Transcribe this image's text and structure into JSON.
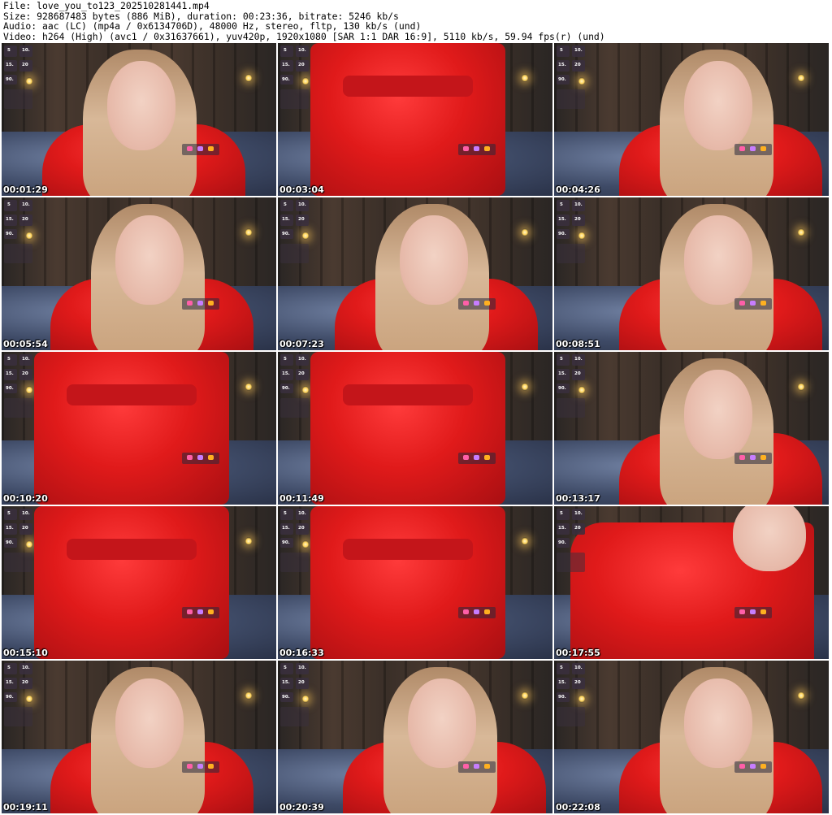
{
  "header": {
    "line1": "File: love_you_to123_202510281441.mp4",
    "line2": "Size: 928687483 bytes (886 MiB), duration: 00:23:36, bitrate: 5246 kb/s",
    "line3": "Audio: aac (LC) (mp4a / 0x6134706D), 48000 Hz, stereo, fltp, 130 kb/s (und)",
    "line4": "Video: h264 (High) (avc1 / 0x31637661), yuv420p, 1920x1080 [SAR 1:1 DAR 16:9], 5110 kb/s, 59.94 fps(r) (und)"
  },
  "thumbnails": [
    {
      "timestamp": "00:01:29",
      "scene": "portrait-left"
    },
    {
      "timestamp": "00:03:04",
      "scene": "robe-closeup"
    },
    {
      "timestamp": "00:04:26",
      "scene": "face-closeup"
    },
    {
      "timestamp": "00:05:54",
      "scene": "face-left"
    },
    {
      "timestamp": "00:07:23",
      "scene": "portrait-center"
    },
    {
      "timestamp": "00:08:51",
      "scene": "face-closeup"
    },
    {
      "timestamp": "00:10:20",
      "scene": "robe-closeup"
    },
    {
      "timestamp": "00:11:49",
      "scene": "robe-closeup"
    },
    {
      "timestamp": "00:13:17",
      "scene": "face-closeup"
    },
    {
      "timestamp": "00:15:10",
      "scene": "robe-closeup"
    },
    {
      "timestamp": "00:16:33",
      "scene": "robe-closeup"
    },
    {
      "timestamp": "00:17:55",
      "scene": "leaning"
    },
    {
      "timestamp": "00:19:11",
      "scene": "face-left"
    },
    {
      "timestamp": "00:20:39",
      "scene": "face-center"
    },
    {
      "timestamp": "00:22:08",
      "scene": "face-closeup"
    }
  ],
  "hud": {
    "top_left": "5",
    "top_right": "10.",
    "mid_left": "15.",
    "mid_right": "20",
    "bottom": "90."
  },
  "colors": {
    "robe": "#e01a1a",
    "background": "#ffffff",
    "timestamp": "#ffffff"
  }
}
